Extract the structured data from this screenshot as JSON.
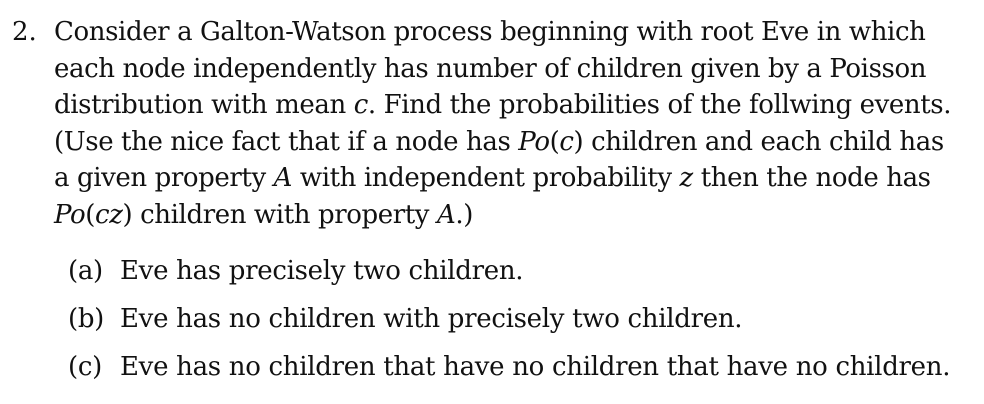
{
  "problem": {
    "number": "2.",
    "lines": [
      [
        "Consider a Galton-Watson process beginning with root Eve in which"
      ],
      [
        "each node independently has number of children given by a Poisson"
      ],
      [
        "distribution with mean ",
        "c",
        ". Find the probabilities of the follwing events."
      ],
      [
        "(Use the nice fact that if a node has ",
        "Po",
        "(",
        "c",
        ") children and each child has"
      ],
      [
        "a given property ",
        "A",
        " with independent probability ",
        "z",
        " then the node has"
      ],
      [
        "Po",
        "(",
        "cz",
        ") children with property ",
        "A",
        ".)"
      ]
    ],
    "parts": [
      {
        "label": "(a)",
        "text": "Eve has precisely two children."
      },
      {
        "label": "(b)",
        "text": "Eve has no children with precisely two children."
      },
      {
        "label": "(c)",
        "text": "Eve has no children that have no children that have no children."
      }
    ]
  }
}
